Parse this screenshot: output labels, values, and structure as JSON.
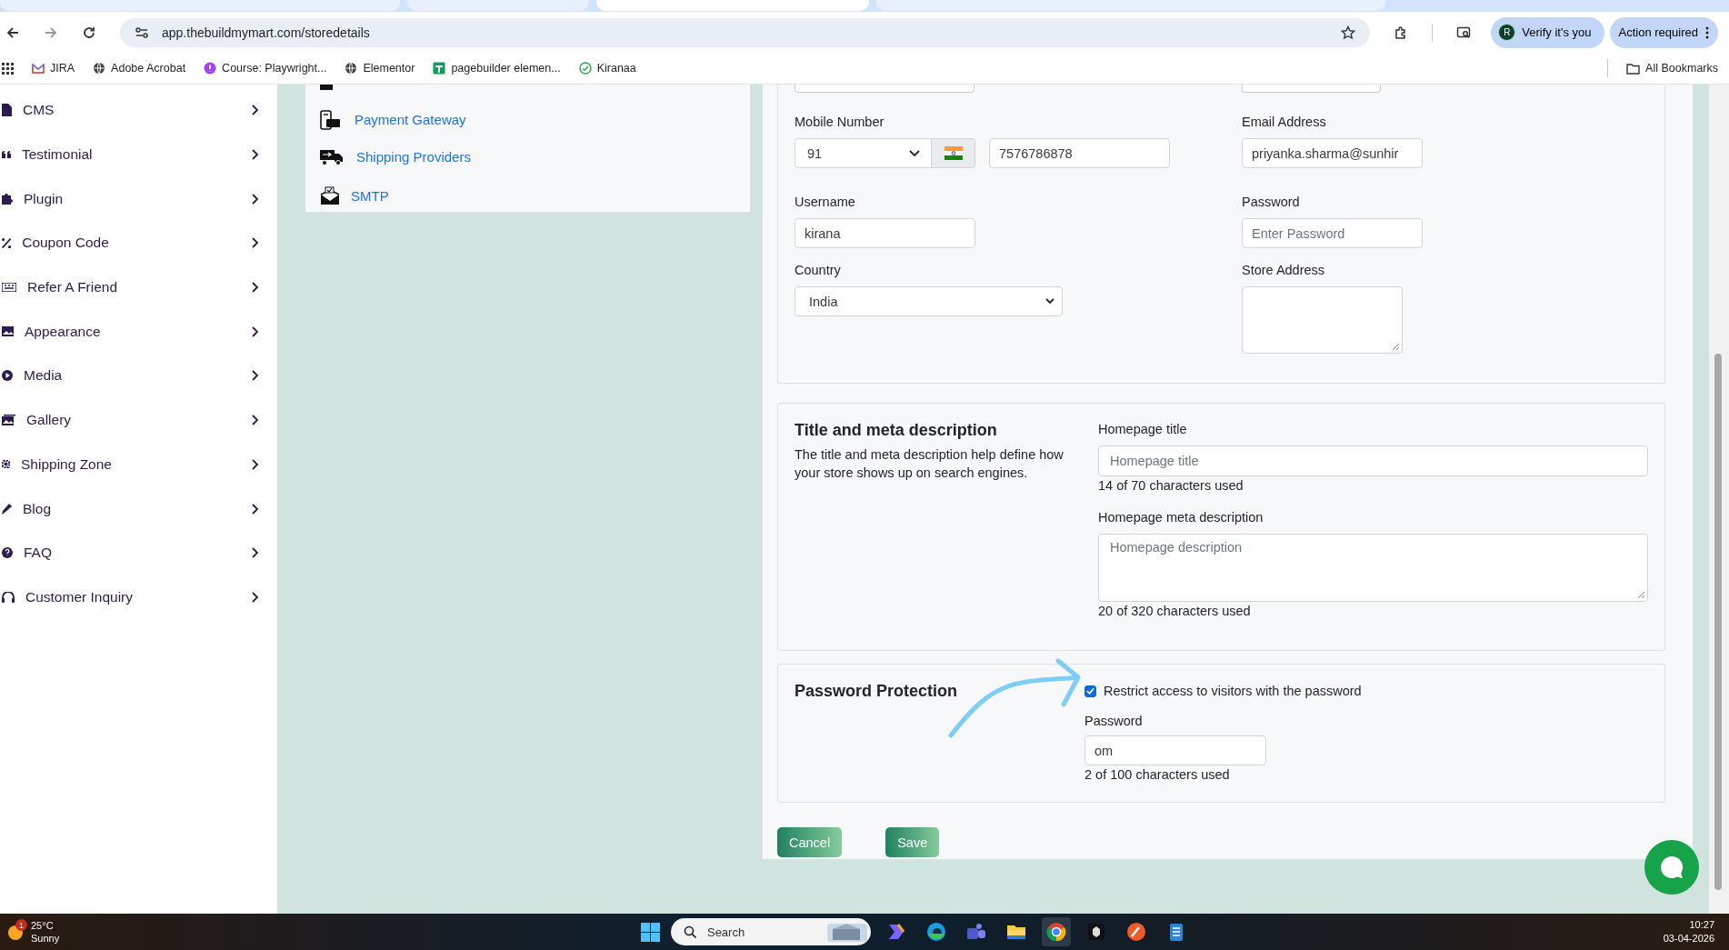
{
  "browser": {
    "tabs": [
      {
        "selected": false
      },
      {
        "selected": false
      },
      {
        "selected": true
      },
      {
        "selected": false
      }
    ],
    "address": "app.thebuildmymart.com/storedetails",
    "profile": {
      "avatar": "R",
      "label": "Verify it's you"
    },
    "action": "Action required",
    "bookmarks": [
      {
        "label": "JIRA"
      },
      {
        "label": "Adobe Acrobat"
      },
      {
        "label": "Course: Playwright..."
      },
      {
        "label": "Elementor"
      },
      {
        "label": "pagebuilder elemen..."
      },
      {
        "label": "Kiranaa"
      }
    ],
    "all_bookmarks": "All Bookmarks"
  },
  "sidebar": {
    "items": [
      {
        "label": "CMS"
      },
      {
        "label": "Testimonial"
      },
      {
        "label": "Plugin"
      },
      {
        "label": "Coupon Code"
      },
      {
        "label": "Refer A Friend"
      },
      {
        "label": "Appearance"
      },
      {
        "label": "Media"
      },
      {
        "label": "Gallery"
      },
      {
        "label": "Shipping Zone"
      },
      {
        "label": "Blog"
      },
      {
        "label": "FAQ"
      },
      {
        "label": "Customer Inquiry"
      }
    ]
  },
  "settings_menu": {
    "items": [
      {
        "label": "Payment Gateway"
      },
      {
        "label": "Shipping Providers"
      },
      {
        "label": "SMTP"
      }
    ]
  },
  "store_details": {
    "rows": [
      {
        "left": {
          "kind": "phone",
          "label": "Mobile Number",
          "code": "91",
          "value": "7576786878"
        },
        "right": {
          "kind": "input",
          "label": "Email Address",
          "value": "priyanka.sharma@sunhir"
        }
      },
      {
        "left": {
          "kind": "input",
          "label": "Username",
          "value": "kirana"
        },
        "right": {
          "kind": "input",
          "label": "Password",
          "placeholder": "Enter Password"
        }
      },
      {
        "left": {
          "kind": "select",
          "label": "Country",
          "value": "India"
        },
        "right": {
          "kind": "textarea",
          "label": "Store Address"
        }
      }
    ]
  },
  "seo": {
    "heading": "Title and meta description",
    "description": "The title and meta description help define how your store shows up on search engines.",
    "fields": [
      {
        "kind": "input",
        "label": "Homepage title",
        "placeholder": "Homepage title",
        "counter": "14 of 70 characters used"
      },
      {
        "kind": "textarea",
        "label": "Homepage meta description",
        "placeholder": "Homepage description",
        "counter": "20 of 320 characters used"
      }
    ]
  },
  "password_protection": {
    "heading": "Password Protection",
    "restrict": {
      "label": "Restrict access to visitors with the password",
      "checked": true
    },
    "password": {
      "label": "Password",
      "value": "om",
      "counter": "2 of 100 characters used"
    }
  },
  "buttons": [
    {
      "label": "Cancel"
    },
    {
      "label": "Save"
    }
  ],
  "taskbar": {
    "weather": {
      "badge": "1",
      "temp": "25°C",
      "condition": "Sunny"
    },
    "search": {
      "placeholder": "Search"
    },
    "time": "10:27",
    "date": "03-04-2026"
  }
}
